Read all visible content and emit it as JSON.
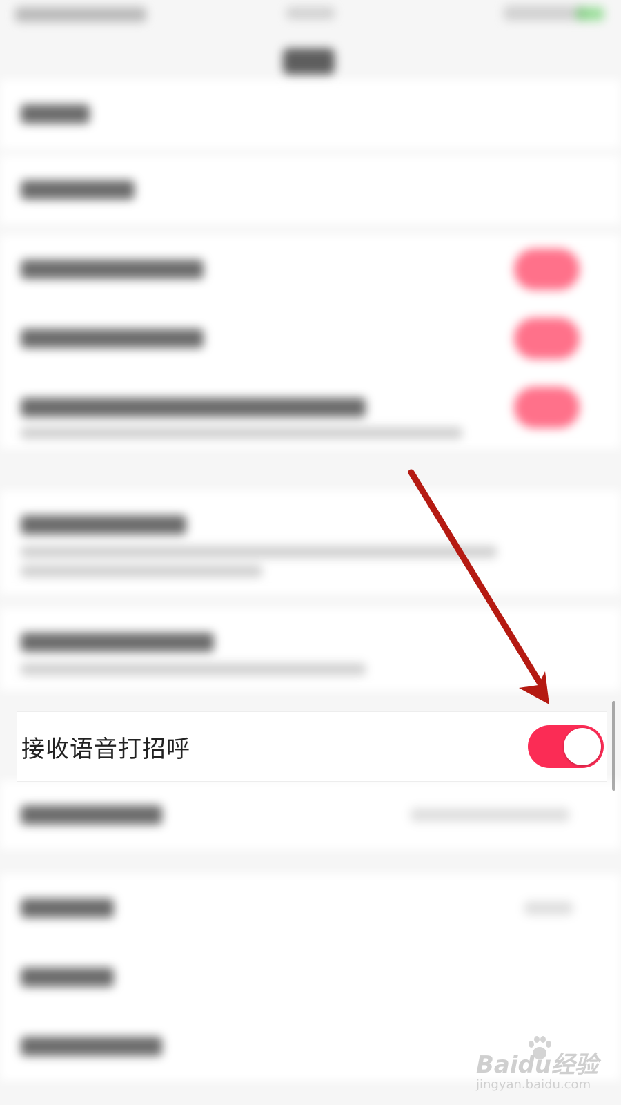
{
  "setting": {
    "label": "接收语音打招呼",
    "enabled": true
  },
  "colors": {
    "toggle_on": "#fb2c55",
    "annotation_arrow": "#b51a12"
  },
  "watermark": {
    "brand": "Baidu经验",
    "url": "jingyan.baidu.com"
  }
}
